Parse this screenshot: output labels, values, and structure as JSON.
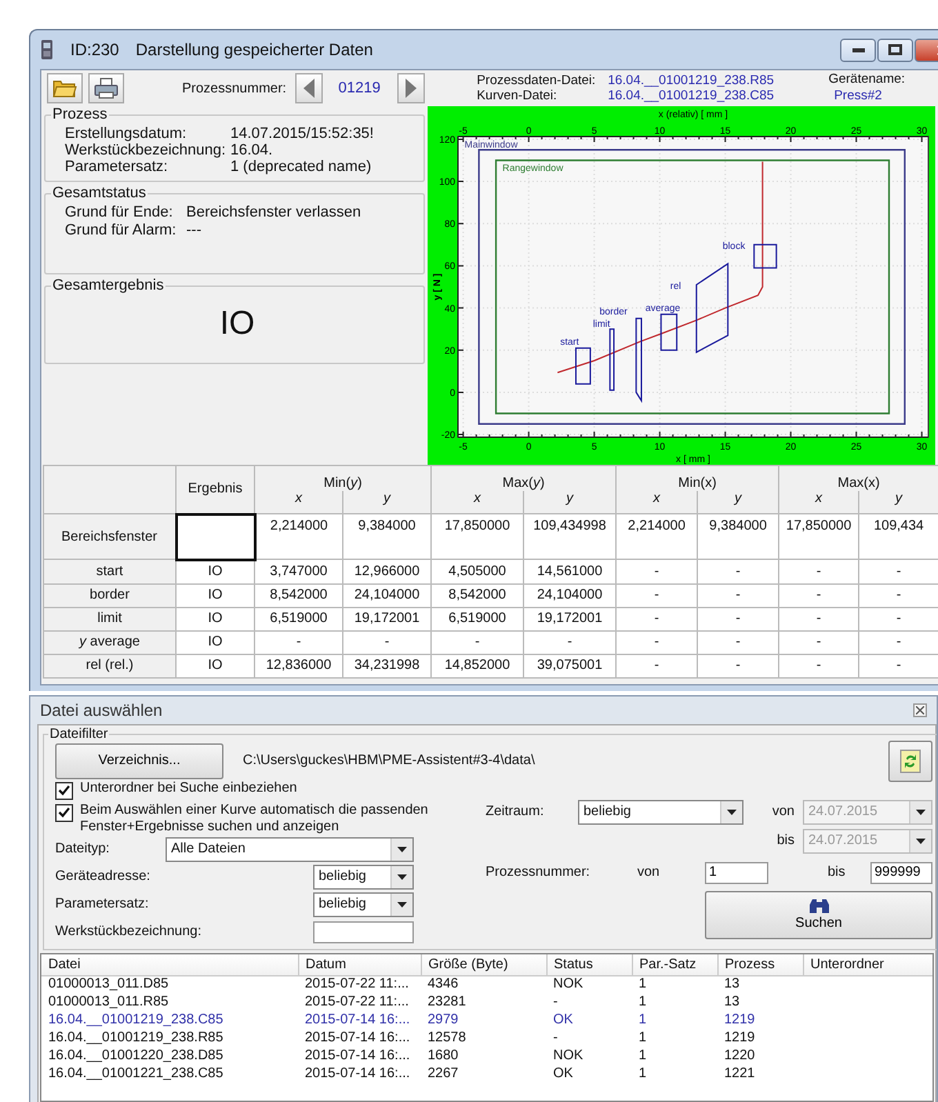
{
  "window": {
    "id": "ID:230",
    "title": "Darstellung gespeicherter Daten"
  },
  "toolbar": {
    "process_label": "Prozessnummer:",
    "process_number": "01219",
    "process_file_label": "Prozessdaten-Datei:",
    "process_file": "16.04.__01001219_238.R85",
    "curve_file_label": "Kurven-Datei:",
    "curve_file": "16.04.__01001219_238.C85",
    "device_label": "Gerätename:",
    "device": "Press#2"
  },
  "process": {
    "title": "Prozess",
    "fields": [
      {
        "label": "Erstellungsdatum:",
        "value": "14.07.2015/15:52:35!"
      },
      {
        "label": "Werkstückbezeichnung:",
        "value": "16.04."
      },
      {
        "label": "Parametersatz:",
        "value": "1 (deprecated name)"
      }
    ]
  },
  "overall_status": {
    "title": "Gesamtstatus",
    "fields": [
      {
        "label": "Grund für Ende:",
        "value": "Bereichsfenster verlassen"
      },
      {
        "label": "Grund für Alarm:",
        "value": "---"
      }
    ]
  },
  "overall_result": {
    "title": "Gesamtergebnis",
    "value": "IO"
  },
  "chart": {
    "chart_data": {
      "type": "line",
      "xlabel": "x [ mm ]",
      "x2label": "x (relativ) [ mm ]",
      "ylabel": "y [ N ]",
      "xlim": [
        -5.4,
        30.5
      ],
      "x2lim": [
        -5.4,
        30.5
      ],
      "ylim": [
        -21.3,
        121.3
      ],
      "xticks": [
        -5,
        0,
        5,
        10,
        15,
        20,
        25,
        30
      ],
      "x2ticks": [
        -5,
        0,
        5,
        10,
        15,
        20,
        25,
        30
      ],
      "yticks": [
        -20,
        0,
        20,
        40,
        60,
        80,
        100,
        120
      ],
      "grid": true,
      "series": [
        {
          "color": "#c0282d",
          "x": [
            2.2,
            5,
            8.5,
            10.2,
            12.8,
            15,
            17.5,
            17.85,
            17.85,
            17.85
          ],
          "values": [
            9.4,
            15,
            24,
            28,
            34.2,
            40,
            46,
            50,
            75,
            109.4
          ]
        }
      ],
      "annotations": [
        "Mainwindow",
        "Rangewindow",
        "start",
        "limit",
        "border",
        "average",
        "rel",
        "block"
      ]
    }
  },
  "results_table": {
    "columns": [
      {
        "kind": "row_header"
      },
      {
        "label": "Ergebnis"
      },
      {
        "label": "Min(*y*)",
        "colspan": 2,
        "sub": [
          "x",
          "y"
        ]
      },
      {
        "label": "Max(*y*)",
        "colspan": 2,
        "sub": [
          "x",
          "y"
        ]
      },
      {
        "label": "Min(x)",
        "colspan": 2,
        "sub": [
          "x",
          "y"
        ]
      },
      {
        "label": "Max(x)",
        "colspan": 2,
        "sub": [
          "x",
          "y"
        ]
      }
    ],
    "rows": [
      {
        "focused": true,
        "cells": [
          "Bereichsfenster",
          "",
          "2,214000",
          "9,384000",
          "17,850000",
          "109,434998",
          "2,214000",
          "9,384000",
          "17,850000",
          "109,434"
        ]
      },
      {
        "focused": false,
        "cells": [
          "start",
          "IO",
          "3,747000",
          "12,966000",
          "4,505000",
          "14,561000",
          "-",
          "-",
          "-",
          "-"
        ]
      },
      {
        "focused": false,
        "cells": [
          "border",
          "IO",
          "8,542000",
          "24,104000",
          "8,542000",
          "24,104000",
          "-",
          "-",
          "-",
          "-"
        ]
      },
      {
        "focused": false,
        "cells": [
          "limit",
          "IO",
          "6,519000",
          "19,172001",
          "6,519000",
          "19,172001",
          "-",
          "-",
          "-",
          "-"
        ]
      },
      {
        "focused": false,
        "cells": [
          "*y* average",
          "IO",
          "-",
          "-",
          "-",
          "-",
          "-",
          "-",
          "-",
          "-"
        ]
      },
      {
        "focused": false,
        "cells": [
          "rel (rel.)",
          "IO",
          "12,836000",
          "34,231998",
          "14,852000",
          "39,075001",
          "-",
          "-",
          "-",
          "-"
        ]
      }
    ]
  },
  "file_dialog": {
    "title": "Datei auswählen",
    "filter": {
      "title": "Dateifilter",
      "directory_button": "Verzeichnis...",
      "path": "C:\\Users\\guckes\\HBM\\PME-Assistent#3-4\\data\\",
      "checkboxes": [
        {
          "label": "Unterordner bei Suche einbeziehen",
          "checked": true
        },
        {
          "label": "Beim Auswählen einer Kurve automatisch die passenden Fenster+Ergebnisse suchen und anzeigen",
          "checked": true
        }
      ],
      "file_type": {
        "label": "Dateityp:",
        "value": "Alle Dateien"
      },
      "device_address": {
        "label": "Geräteadresse:",
        "value": "beliebig"
      },
      "parameter_set": {
        "label": "Parametersatz:",
        "value": "beliebig"
      },
      "workpiece": {
        "label": "Werkstückbezeichnung:"
      },
      "period": {
        "label": "Zeitraum:",
        "value": "beliebig"
      },
      "date_from": {
        "label": "von",
        "value": "24.07.2015",
        "disabled": true
      },
      "date_to": {
        "label": "bis",
        "value": "24.07.2015",
        "disabled": true
      },
      "process_number": {
        "label": "Prozessnummer:",
        "from_label": "von",
        "from": "1",
        "to_label": "bis",
        "to": "999999"
      },
      "search_button": "Suchen"
    },
    "files": {
      "columns": [
        "Datei",
        "Datum",
        "Größe (Byte)",
        "Status",
        "Par.-Satz",
        "Prozess",
        "Unterordner"
      ],
      "rows": [
        {
          "current": false,
          "cells": [
            "01000013_011.D85",
            "2015-07-22 11:...",
            "4346",
            "NOK",
            "1",
            "13"
          ]
        },
        {
          "current": false,
          "cells": [
            "01000013_011.R85",
            "2015-07-22 11:...",
            "23281",
            "-",
            "1",
            "13"
          ]
        },
        {
          "current": true,
          "cells": [
            "16.04.__01001219_238.C85",
            "2015-07-14 16:...",
            "2979",
            "OK",
            "1",
            "1219"
          ]
        },
        {
          "current": false,
          "cells": [
            "16.04.__01001219_238.R85",
            "2015-07-14 16:...",
            "12578",
            "-",
            "1",
            "1219"
          ]
        },
        {
          "current": false,
          "cells": [
            "16.04.__01001220_238.D85",
            "2015-07-14 16:...",
            "1680",
            "NOK",
            "1",
            "1220"
          ]
        },
        {
          "current": false,
          "cells": [
            "16.04.__01001221_238.C85",
            "2015-07-14 16:...",
            "2267",
            "OK",
            "1",
            "1221"
          ]
        }
      ]
    }
  }
}
